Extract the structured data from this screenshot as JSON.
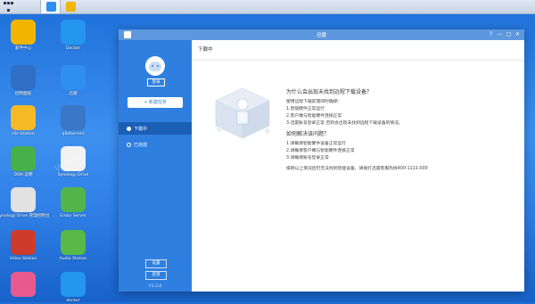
{
  "desktop_icons": [
    {
      "label": "套件中心",
      "icon": "package-center-icon",
      "color": "#f1b500"
    },
    {
      "label": "Docker",
      "icon": "docker-whale-icon",
      "color": "#2496ed"
    },
    {
      "label": "控制面板",
      "icon": "control-panel-icon",
      "color": "#2f6fc5"
    },
    {
      "label": "迅雷",
      "icon": "thunder-bird-icon",
      "color": "#2f8ff0"
    },
    {
      "label": "File Station",
      "icon": "folder-icon",
      "color": "#f6b926"
    },
    {
      "label": "qBittorrent",
      "icon": "qbittorrent-icon",
      "color": "#3a77c6"
    },
    {
      "label": "DSM 说明",
      "icon": "help-question-icon",
      "color": "#48b04a"
    },
    {
      "label": "Synology Drive",
      "icon": "synology-drive-icon",
      "color": "#f2f2f2"
    },
    {
      "label": "Synology Drive 管理控制台",
      "icon": "drive-admin-icon",
      "color": "#e2e2e2"
    },
    {
      "label": "Emby Server",
      "icon": "emby-icon",
      "color": "#52b54b"
    },
    {
      "label": "Video Station",
      "icon": "video-station-icon",
      "color": "#cf3a2b"
    },
    {
      "label": "Audio Station",
      "icon": "audio-station-icon",
      "color": "#58b947"
    },
    {
      "label": "",
      "icon": "photos-icon",
      "color": "#e85a8e"
    },
    {
      "label": "docker",
      "icon": "docker-logo-icon",
      "color": "#2496ed"
    }
  ],
  "window": {
    "title": "迅雷",
    "controls": [
      "?",
      "—",
      "□",
      "✕"
    ]
  },
  "sidebar": {
    "login_label": "登录",
    "new_task_label": "+ 新建任务",
    "nav": [
      {
        "label": "下载中",
        "active": true
      },
      {
        "label": "已完成",
        "active": false
      }
    ],
    "settings_label": "设置",
    "feedback_label": "反馈",
    "version": "V1.2.0"
  },
  "main": {
    "heading": "下载中",
    "q1_title": "为什么会出现未找到远程下载设备？",
    "q1_intro": "使用远程下载前需同时确保：",
    "q1_items": [
      "1.智能硬件正常运行",
      "2.客户端与智能硬件连接正常",
      "3.迅雷账号登录正常 否则会出现未找到远程下载设备的情况。"
    ],
    "q2_title": "如何解决该问题？",
    "q2_items": [
      "1.请确保智能硬件设备正常运行",
      "2.请确保客户端与智能硬件连接正常",
      "3.请确保账号登录正常"
    ],
    "footer_note": "排除以上情况后仍无法找到智能设备，请拨打迅雷客服热线400-1111-000"
  },
  "colors": {
    "accent": "#2e7fdf",
    "nav_active": "#1b5fb5",
    "titlebar": "#5d97de"
  }
}
